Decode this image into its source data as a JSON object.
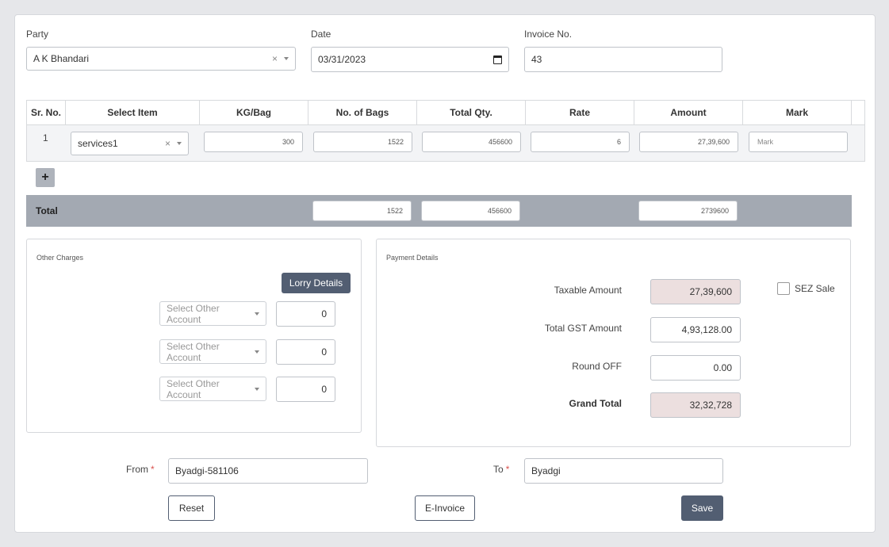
{
  "header": {
    "party_label": "Party",
    "party_value": "A K Bhandari",
    "date_label": "Date",
    "date_value": "03/31/2023",
    "invoice_label": "Invoice No.",
    "invoice_value": "43"
  },
  "table": {
    "columns": [
      "Sr. No.",
      "Select Item",
      "KG/Bag",
      "No. of Bags",
      "Total Qty.",
      "Rate",
      "Amount",
      "Mark"
    ],
    "rows": [
      {
        "sr": "1",
        "item": "services1",
        "kg_bag": "300",
        "bags": "1522",
        "qty": "456600",
        "rate": "6",
        "amount": "27,39,600",
        "mark_placeholder": "Mark"
      }
    ],
    "add_label": "+",
    "total_label": "Total",
    "total_bags": "1522",
    "total_qty": "456600",
    "total_amount": "2739600"
  },
  "other_charges": {
    "title": "Other Charges",
    "lorry_button": "Lorry Details",
    "accounts": [
      {
        "placeholder": "Select Other Account",
        "value": "0"
      },
      {
        "placeholder": "Select Other Account",
        "value": "0"
      },
      {
        "placeholder": "Select Other Account",
        "value": "0"
      }
    ]
  },
  "payment": {
    "title": "Payment Details",
    "taxable_label": "Taxable Amount",
    "taxable_value": "27,39,600",
    "gst_label": "Total GST Amount",
    "gst_value": "4,93,128.00",
    "round_label": "Round OFF",
    "round_value": "0.00",
    "grand_label": "Grand Total",
    "grand_value": "32,32,728",
    "sez_label": "SEZ Sale"
  },
  "route": {
    "from_label": "From",
    "from_value": "Byadgi-581106",
    "to_label": "To",
    "to_value": "Byadgi",
    "required_mark": "*"
  },
  "actions": {
    "reset": "Reset",
    "einvoice": "E-Invoice",
    "save": "Save"
  }
}
